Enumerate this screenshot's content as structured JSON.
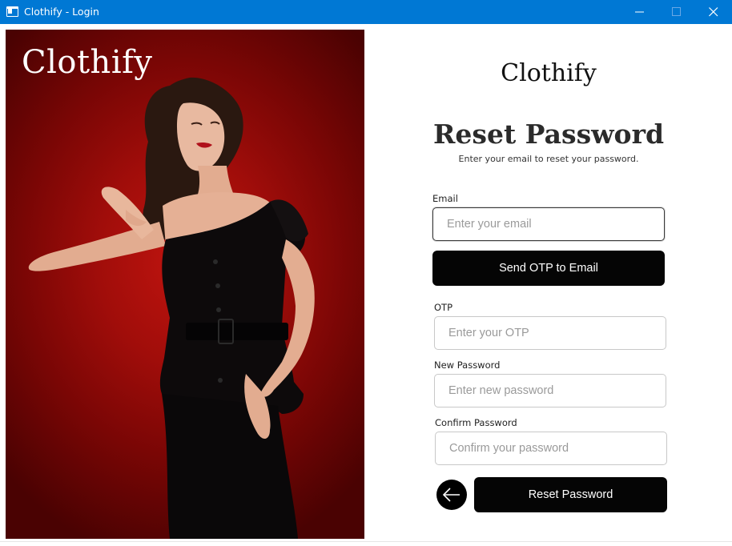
{
  "window": {
    "title": "Clothify - Login"
  },
  "hero": {
    "logo": "Clothify"
  },
  "form": {
    "brand": "Clothify",
    "heading": "Reset Password",
    "subheading": "Enter your email to reset your password.",
    "email": {
      "label": "Email",
      "placeholder": "Enter your email",
      "value": ""
    },
    "send_otp_label": "Send OTP to Email",
    "otp": {
      "label": "OTP",
      "placeholder": "Enter your OTP",
      "value": ""
    },
    "new_password": {
      "label": "New Password",
      "placeholder": "Enter new password",
      "value": ""
    },
    "confirm_password": {
      "label": "Confirm Password",
      "placeholder": "Confirm your password",
      "value": ""
    },
    "reset_label": "Reset Password"
  },
  "icons": {
    "app": "window-icon",
    "back": "arrow-left-icon",
    "minimize": "minimize-icon",
    "maximize": "maximize-icon",
    "close": "close-icon"
  },
  "colors": {
    "titlebar": "#0078d4",
    "button": "#050505",
    "hero_red": "#a00d0a"
  }
}
